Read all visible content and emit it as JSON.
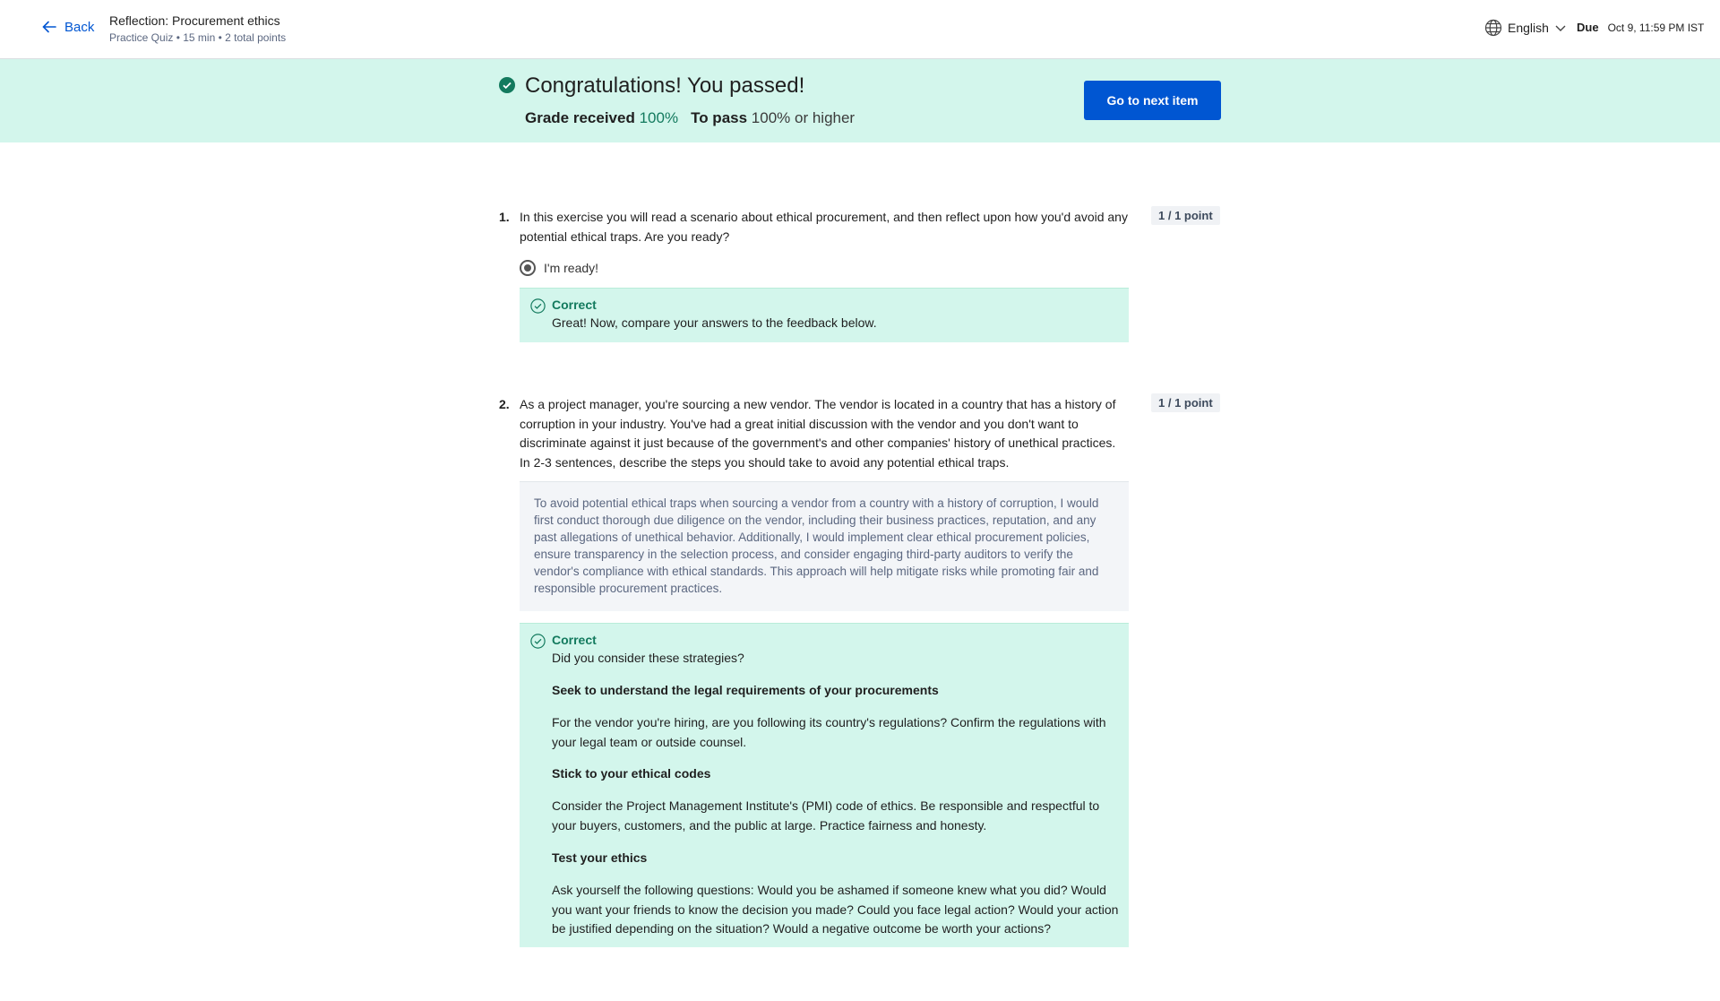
{
  "header": {
    "back_label": "Back",
    "title": "Reflection: Procurement ethics",
    "subtitle": "Practice Quiz • 15 min • 2 total points",
    "language": "English",
    "due_label": "Due",
    "due_date": "Oct 9, 11:59 PM IST"
  },
  "banner": {
    "headline": "Congratulations! You passed!",
    "grade_label": "Grade received",
    "grade_value": "100%",
    "pass_label": "To pass",
    "pass_value": "100% or higher",
    "next_button": "Go to next item"
  },
  "questions": [
    {
      "number": "1.",
      "text": "In this exercise you will read a scenario about ethical procurement, and then reflect upon how you'd avoid any potential ethical traps. Are you ready?",
      "points": "1 / 1 point",
      "option": "I'm ready!",
      "feedback_title": "Correct",
      "feedback_text": "Great! Now, compare your answers to the feedback below."
    },
    {
      "number": "2.",
      "text": "As a project manager, you're sourcing a new vendor. The vendor is located in a country that has a history of corruption in your industry. You've had a great initial discussion with the vendor and you don't want to discriminate against it just because of the government's and other companies' history of unethical practices. In 2-3 sentences, describe the steps you should take to avoid any potential ethical traps.",
      "points": "1 / 1 point",
      "answer": "To avoid potential ethical traps when sourcing a vendor from a country with a history of corruption, I would first conduct thorough due diligence on the vendor, including their business practices, reputation, and any past allegations of unethical behavior. Additionally, I would implement clear ethical procurement policies, ensure transparency in the selection process, and consider engaging third-party auditors to verify the vendor's compliance with ethical standards. This approach will help mitigate risks while promoting fair and responsible procurement practices.",
      "feedback_title": "Correct",
      "feedback_intro": "Did you consider these strategies?",
      "strategies": [
        {
          "heading": "Seek to understand the legal requirements of your procurements",
          "body": "For the vendor you're hiring, are you following its country's regulations? Confirm the regulations with your legal team or outside counsel."
        },
        {
          "heading": "Stick to your ethical codes",
          "body": "Consider the Project Management Institute's (PMI) code of ethics. Be responsible and respectful to your buyers, customers, and the public at large. Practice fairness and honesty."
        },
        {
          "heading": "Test your ethics",
          "body": "Ask yourself the following questions: Would you be ashamed if someone knew what you did? Would you want your friends to know the decision you made? Could you face legal action? Would your action be justified depending on the situation? Would a negative outcome be worth your actions?"
        }
      ]
    }
  ],
  "colors": {
    "accent": "#0056d2",
    "success_bg": "#d3f6ec",
    "success_text": "#137a5e"
  }
}
